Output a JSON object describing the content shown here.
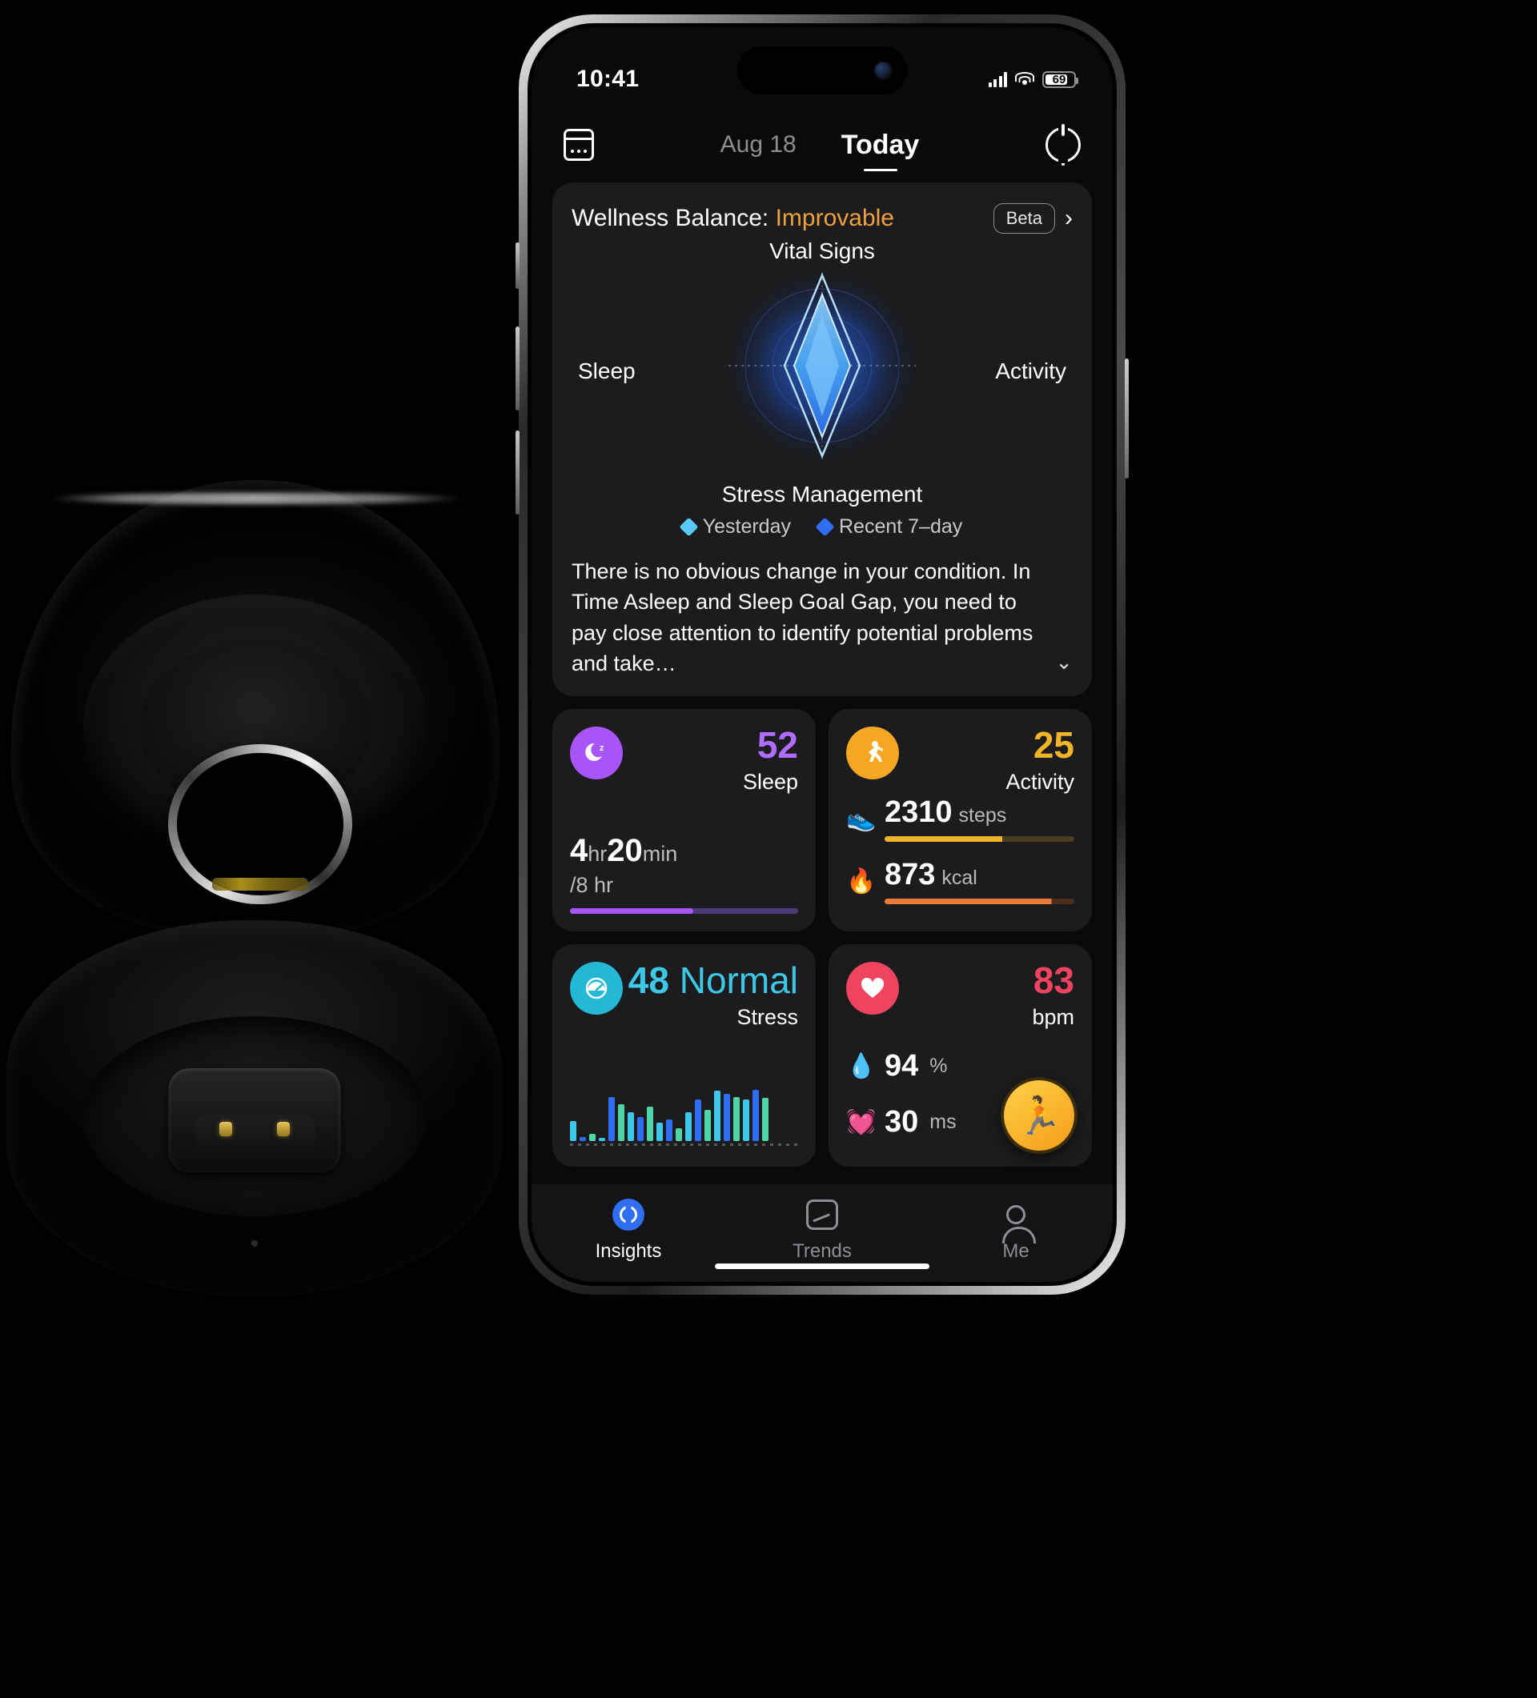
{
  "status_bar": {
    "time": "10:41",
    "battery_level": "69",
    "wifi_icon": "wifi-icon",
    "signal_icon": "cellular-signal-icon"
  },
  "nav": {
    "calendar_icon": "calendar-icon",
    "date": "Aug 18",
    "today": "Today",
    "sync_icon": "sync-icon"
  },
  "wellness": {
    "title_prefix": "Wellness Balance: ",
    "status": "Improvable",
    "status_color": "#f0a03c",
    "beta_badge": "Beta",
    "chevron_right": "›",
    "axes": {
      "top": "Vital Signs",
      "left": "Sleep",
      "right": "Activity",
      "bottom": "Stress Management"
    },
    "legend": [
      {
        "label": "Yesterday",
        "color": "#5ac8f5"
      },
      {
        "label": "Recent 7–day",
        "color": "#2f6ef0"
      }
    ],
    "insight": "There is no obvious change in your condition. In Time Asleep and Sleep Goal Gap, you need to pay close attention to identify potential problems and take…",
    "chevron_down": "⌄"
  },
  "metrics": {
    "sleep": {
      "icon": "sleep-moon-icon",
      "icon_color": "#a855f7",
      "score": "52",
      "label": "Sleep",
      "duration_hours": "4",
      "unit_hr": "hr",
      "duration_minutes": "20",
      "unit_min": "min",
      "goal": "/8 hr",
      "progress_percent": 54,
      "bar_color": "#a855f7",
      "track_color": "#4b3a74"
    },
    "activity": {
      "icon": "running-person-icon",
      "icon_color": "#f5a623",
      "score": "25",
      "label": "Activity",
      "rows": [
        {
          "icon": "shoe-icon",
          "emoji": "👟",
          "value": "2310",
          "unit": "steps",
          "percent": 62,
          "color": "#f0b429"
        },
        {
          "icon": "flame-icon",
          "emoji": "🔥",
          "value": "873",
          "unit": "kcal",
          "percent": 88,
          "color": "#f07a3c"
        }
      ]
    },
    "stress": {
      "icon": "stress-gauge-icon",
      "icon_color": "#22b8d6",
      "score": "48",
      "status": "Normal",
      "label": "Stress",
      "status_color": "#3ec8e8",
      "bars": [
        28,
        6,
        10,
        4,
        62,
        52,
        40,
        34,
        48,
        26,
        30,
        18,
        40,
        58,
        44,
        70,
        66,
        62,
        58,
        72,
        60
      ]
    },
    "heart": {
      "icon": "heart-icon",
      "icon_color": "#ef4360",
      "score": "83",
      "label": "bpm",
      "rows": [
        {
          "icon": "blood-oxygen-droplet-icon",
          "emoji": "💧",
          "value": "94",
          "unit": "%"
        },
        {
          "icon": "hrv-heartbeat-icon",
          "emoji": "💓",
          "value": "30",
          "unit": "ms"
        }
      ],
      "fab_icon": "workout-run-icon",
      "fab_emoji": "🏃"
    }
  },
  "tabs": [
    {
      "label": "Insights",
      "icon": "insights-ring-icon",
      "active": true
    },
    {
      "label": "Trends",
      "icon": "trends-chart-icon",
      "active": false
    },
    {
      "label": "Me",
      "icon": "profile-person-icon",
      "active": false
    }
  ],
  "chart_data": {
    "type": "radar",
    "title": "Wellness Balance",
    "categories": [
      "Vital Signs",
      "Activity",
      "Stress Management",
      "Sleep"
    ],
    "series": [
      {
        "name": "Yesterday",
        "color": "#5ac8f5",
        "values": [
          0.98,
          0.3,
          0.94,
          0.3
        ]
      },
      {
        "name": "Recent 7–day",
        "color": "#2f6ef0",
        "values": [
          0.74,
          0.24,
          0.7,
          0.24
        ]
      }
    ],
    "rmax": 1.0,
    "legend_position": "bottom"
  },
  "stress_chart_data": {
    "type": "bar",
    "title": "Stress",
    "values": [
      28,
      6,
      10,
      4,
      62,
      52,
      40,
      34,
      48,
      26,
      30,
      18,
      40,
      58,
      44,
      70,
      66,
      62,
      58,
      72,
      60
    ],
    "ymax": 100,
    "colors": [
      "#3ec8e8",
      "#2f6ef0",
      "#4fd6a8"
    ]
  }
}
